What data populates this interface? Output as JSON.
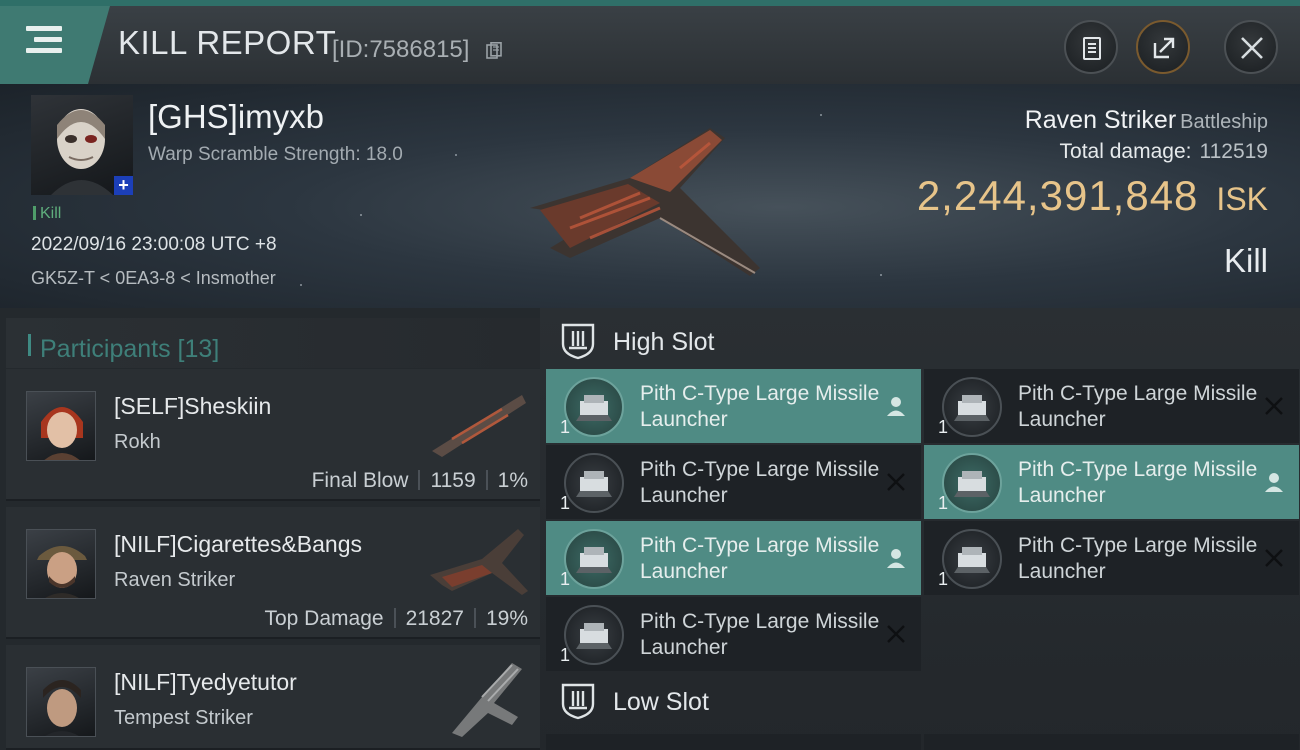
{
  "header": {
    "title": "KILL REPORT",
    "id": "[ID:7586815]",
    "menu_icon": "hamburger-icon",
    "buttons": [
      "clipboard-icon",
      "share-icon",
      "close-icon"
    ]
  },
  "victim": {
    "name": "[GHS]imyxb",
    "scramble": "Warp Scramble Strength: 18.0",
    "tag": "Kill",
    "time": "2022/09/16 23:00:08 UTC +8",
    "location": "GK5Z-T < 0EA3-8 < Insmother",
    "ship_name": "Raven Striker",
    "ship_class": "Battleship",
    "damage_label": "Total damage:",
    "damage_value": "112519",
    "isk_value": "2,244,391,848",
    "isk_unit": "ISK",
    "result": "Kill"
  },
  "participants": {
    "title": "Participants [13]",
    "items": [
      {
        "name": "[SELF]Sheskiin",
        "ship": "Rokh",
        "role": "Final Blow",
        "damage": "1159",
        "percent": "1%"
      },
      {
        "name": "[NILF]Cigarettes&Bangs",
        "ship": "Raven Striker",
        "role": "Top Damage",
        "damage": "21827",
        "percent": "19%"
      },
      {
        "name": "[NILF]Tyedyetutor",
        "ship": "Tempest Striker"
      }
    ]
  },
  "fitting": {
    "high_slot_label": "High Slot",
    "low_slot_label": "Low Slot",
    "modules": [
      {
        "name": "Pith C-Type Large Missile Launcher",
        "count": "1",
        "state": "occupied"
      },
      {
        "name": "Pith C-Type Large Missile Launcher",
        "count": "1",
        "state": "destroyed"
      },
      {
        "name": "Pith C-Type Large Missile Launcher",
        "count": "1",
        "state": "destroyed"
      },
      {
        "name": "Pith C-Type Large Missile Launcher",
        "count": "1",
        "state": "occupied"
      },
      {
        "name": "Pith C-Type Large Missile Launcher",
        "count": "1",
        "state": "occupied"
      },
      {
        "name": "Pith C-Type Large Missile Launcher",
        "count": "1",
        "state": "destroyed"
      },
      {
        "name": "Pith C-Type Large Missile Launcher",
        "count": "1",
        "state": "destroyed"
      }
    ]
  },
  "colors": {
    "accent_teal": "#4f8b84",
    "isk_gold": "#e7c48a",
    "kill_green": "#5fae7d"
  }
}
